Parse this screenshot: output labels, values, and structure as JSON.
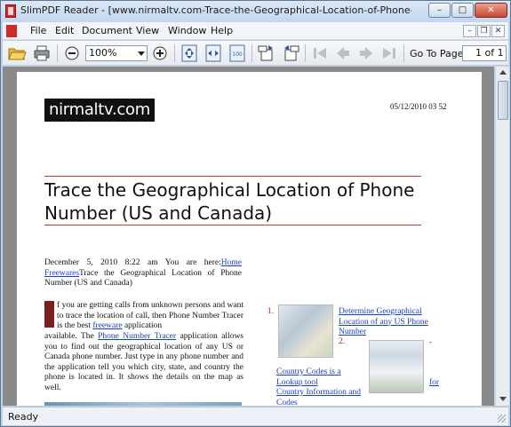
{
  "window": {
    "title": "SlimPDF Reader - [www.nirmaltv.com-Trace-the-Geographical-Location-of-Phone-Number-us-an...",
    "minimize_glyph": "–",
    "maximize_glyph": "□",
    "close_glyph": "✕"
  },
  "menu": {
    "items": [
      "File",
      "Edit",
      "Document",
      "View",
      "Window",
      "Help"
    ],
    "mdi_minimize": "–",
    "mdi_restore": "❐",
    "mdi_close": "✕"
  },
  "toolbar": {
    "zoom_value": "100%",
    "goto_label": "Go To Page",
    "page_value": "1 of 1",
    "icons": [
      "open-folder-icon",
      "print-icon",
      "zoom-out-icon",
      "zoom-in-icon",
      "fit-page-icon",
      "fit-width-icon",
      "actual-size-icon",
      "rotate-cw-icon",
      "rotate-ccw-icon",
      "first-page-icon",
      "prev-page-icon",
      "next-page-icon",
      "last-page-icon"
    ]
  },
  "document": {
    "logo": "nirmaltv.com",
    "date": "05/12/2010 03 52",
    "headline": "Trace the Geographical Location of Phone Number (US and Canada)",
    "meta_prefix": "December 5, 2010 8:22 am You are here:",
    "meta_link_home": "Home",
    "meta_link_freewares": "Freewares",
    "meta_suffix": "Trace the Geographical Location of Phone Number (US and Canada)",
    "para_start": "f you are getting calls from unknown persons and want to trace the location of call, then Phone Number Tracer is the best ",
    "para_link_freeware": "freeware",
    "para_mid": " application",
    "para2_start": "available. The ",
    "para2_link": "Phone Number Tracer",
    "para2_rest": " application allows you to find out the geographical location of any US or Canada phone number. Just type in any phone number and the application tell you which city, state, and country the phone is located in. It shows the details on the map as well.",
    "right_list": [
      {
        "num": "1.",
        "text": "Determine Geographical Location of any US Phone Number"
      },
      {
        "num": "2.",
        "text": ""
      }
    ],
    "right_link_a": "Country Codes is a Lookup tool",
    "right_link_b": "for",
    "right_link_c": "Country Information and Codes",
    "dash": "-"
  },
  "status": {
    "text": "Ready"
  },
  "colors": {
    "accent_red": "#c23a3a",
    "link_blue": "#1a3fc0",
    "dropcap": "#7a1f1f"
  }
}
